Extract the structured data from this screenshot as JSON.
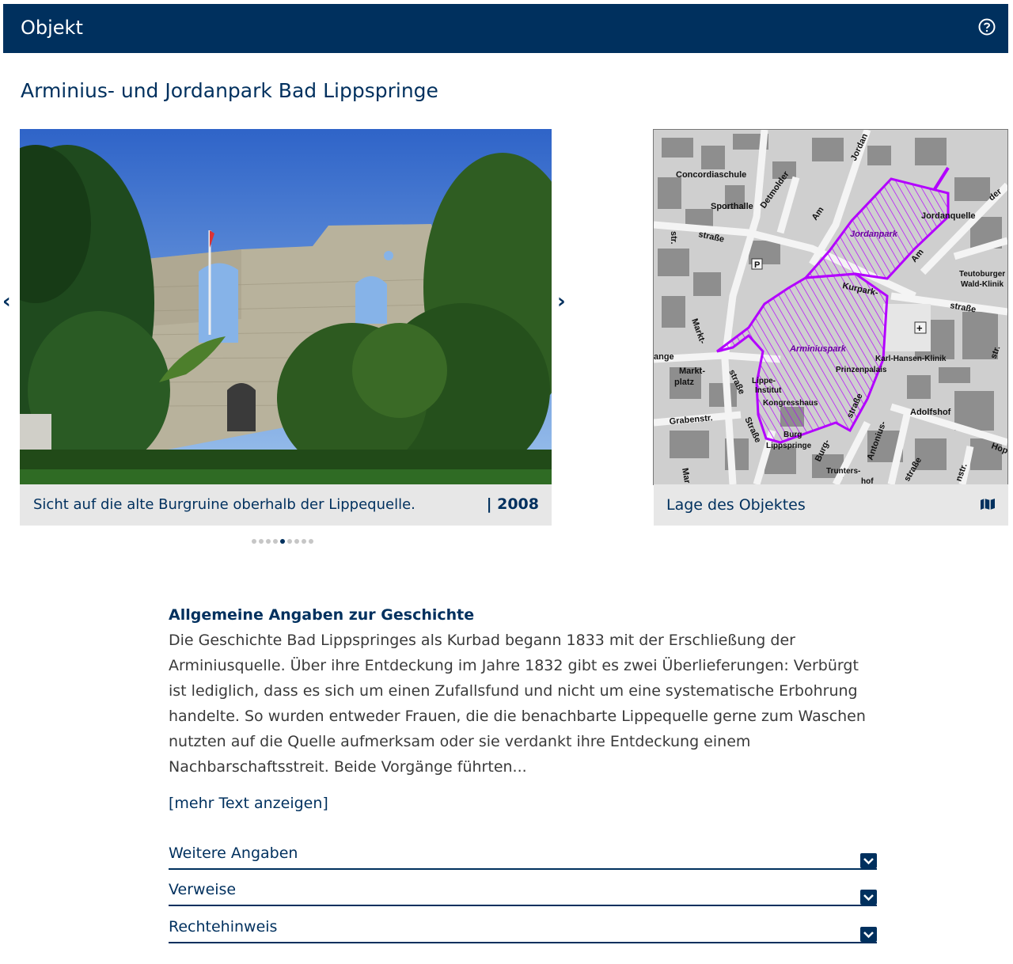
{
  "header": {
    "title": "Objekt",
    "help_icon": "help-circle-icon"
  },
  "page": {
    "title": "Arminius- und Jordanpark Bad Lippspringe"
  },
  "carousel": {
    "prev_label": "‹",
    "next_label": "›",
    "dot_count": 8,
    "active_dot": 4,
    "photo": {
      "caption": "Sicht auf die alte Burgruine oberhalb der Lippequelle.",
      "year": "| 2008"
    }
  },
  "map": {
    "caption": "Lage des Objektes",
    "map_icon": "map-icon",
    "labels": {
      "concordiaschule": "Concordiaschule",
      "sporthalle": "Sporthalle",
      "detmolder": "Detmolder",
      "strasse1": "straße",
      "str": "str.",
      "am": "Am",
      "jordan": "Jordan",
      "jordanquelle": "Jordanquelle",
      "jordanpark": "Jordanpark",
      "der": "der",
      "am2": "Am",
      "teutoburger": "Teutoburger",
      "wald_klinik": "Wald-Klinik",
      "kurpark": "Kurpark-",
      "strasse2": "straße",
      "markt": "Markt-",
      "arminiuspark": "Arminiuspark",
      "karl_hansen": "Karl-Hansen-Klinik",
      "lange": "ange",
      "marktplatz1": "Markt-",
      "marktplatz2": "platz",
      "prinzenpalais": "Prinzenpalais",
      "lippe_institut1": "Lippe-",
      "lippe_institut2": "Institut",
      "kongresshaus": "Kongresshaus",
      "grabenstr": "Grabenstr.",
      "strasse3": "Straße",
      "strasse4": "straße",
      "strasse5": "straße",
      "adolfshof": "Adolfshof",
      "burg": "Burg",
      "lippspringe": "Lippspringe",
      "burg2": "Burg-",
      "antonius": "Antonius-",
      "trunters": "Trunters-",
      "hof": "hof",
      "hop": "Hop",
      "str2": "str.",
      "nstr": "nstr.",
      "mar": "Mar",
      "strasse6": "straße"
    }
  },
  "history": {
    "heading": "Allgemeine Angaben zur Geschichte",
    "text": "Die Geschichte Bad Lippspringes als Kurbad begann 1833 mit der Erschließung der Arminiusquelle. Über ihre Entdeckung im Jahre 1832 gibt es zwei Überlieferungen: Verbürgt ist lediglich, dass es sich um einen Zufallsfund und nicht um eine systematische Erbohrung handelte. So wurden entweder Frauen, die die benachbarte Lippequelle gerne zum Waschen nutzten auf die Quelle aufmerksam oder sie verdankt ihre Entdeckung einem Nachbarschaftsstreit. Beide Vorgänge führten...",
    "more_link": "[mehr Text anzeigen]"
  },
  "accordions": [
    {
      "label": "Weitere Angaben"
    },
    {
      "label": "Verweise"
    },
    {
      "label": "Rechtehinweis"
    }
  ],
  "colors": {
    "primary": "#00305e",
    "caption_bg": "#e7e7e7",
    "park_outline": "#b300ff"
  }
}
